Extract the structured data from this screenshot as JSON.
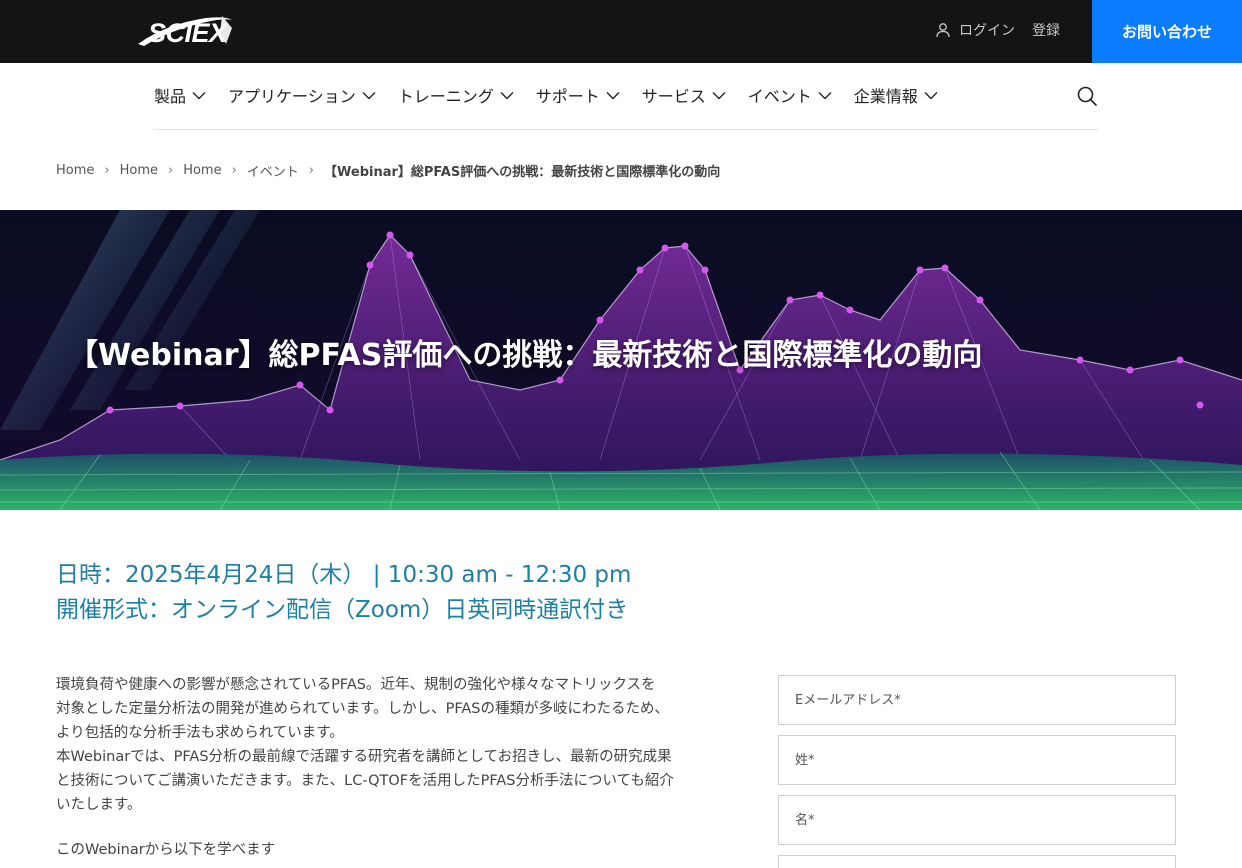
{
  "header": {
    "logo_text": "SCIEX",
    "login": "ログイン",
    "register": "登録",
    "contact": "お問い合わせ"
  },
  "nav": {
    "items": [
      "製品",
      "アプリケーション",
      "トレーニング",
      "サポート",
      "サービス",
      "イベント",
      "企業情報"
    ]
  },
  "breadcrumb": {
    "items": [
      "Home",
      "Home",
      "Home",
      "イベント"
    ],
    "current": "【Webinar】総PFAS評価への挑戦：最新技術と国際標準化の動向"
  },
  "hero": {
    "title": "【Webinar】総PFAS評価への挑戦：最新技術と国際標準化の動向"
  },
  "event": {
    "date": "日時：2025年4月24日（木） | 10:30 am - 12:30 pm",
    "format": "開催形式：オンライン配信（Zoom）日英同時通訳付き"
  },
  "description": {
    "lines": [
      "環境負荷や健康への影響が懸念されているPFAS。近年、規制の強化や様々なマトリックスを",
      "対象とした定量分析法の開発が進められています。しかし、PFASの種類が多岐にわたるため、",
      "より包括的な分析手法も求められています。",
      "本Webinarでは、PFAS分析の最前線で活躍する研究者を講師としてお招きし、最新の研究成果",
      "と技術についてご講演いただきます。また、LC-QTOFを活用したPFAS分析手法についても紹介",
      "いたします。"
    ],
    "learn": "このWebinarから以下を学べます"
  },
  "form": {
    "email_placeholder": "Eメールアドレス*",
    "last_name_placeholder": "姓*",
    "first_name_placeholder": "名*"
  },
  "colors": {
    "topbar": "#141414",
    "accent": "#0a7cff",
    "event_text": "#1c7fa3"
  }
}
